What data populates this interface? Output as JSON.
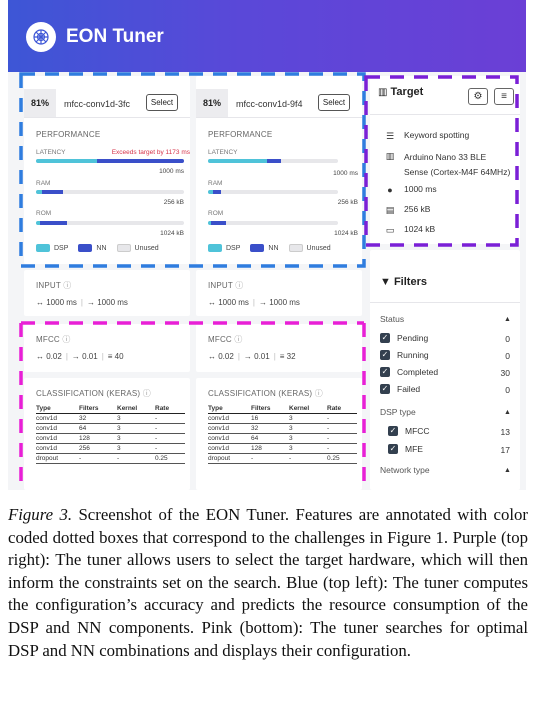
{
  "app": {
    "title": "EON Tuner"
  },
  "colors": {
    "dsp": "#4fc3d9",
    "nn": "#3a4fc9",
    "unused": "#e7e7ea",
    "purple_box": "#7a1fd6",
    "blue_box": "#2f7ddf",
    "pink_box": "#e81fd6"
  },
  "configs": [
    {
      "accuracy": "81%",
      "name": "mfcc-conv1d-3fc",
      "select_label": "Select",
      "performance_label": "PERFORMANCE",
      "latency_label": "LATENCY",
      "latency_note": "Exceeds target by 1173 ms",
      "latency_value": "1000 ms",
      "latency_dsp_pct": 41,
      "latency_nn_pct": 59,
      "ram_label": "RAM",
      "ram_value": "256 kB",
      "ram_dsp_pct": 4,
      "ram_nn_pct": 14,
      "rom_label": "ROM",
      "rom_value": "1024 kB",
      "rom_dsp_pct": 3,
      "rom_nn_pct": 18,
      "input_label": "INPUT",
      "input_window": "1000 ms",
      "input_stride": "1000 ms",
      "dsp_label": "MFCC",
      "dsp_frame": "0.02",
      "dsp_stride": "0.01",
      "dsp_coeffs": "40",
      "nn_label": "CLASSIFICATION (KERAS)",
      "table_head": [
        "Type",
        "Filters",
        "Kernel",
        "Rate"
      ],
      "rows": [
        [
          "conv1d",
          "32",
          "3",
          "-"
        ],
        [
          "conv1d",
          "64",
          "3",
          "-"
        ],
        [
          "conv1d",
          "128",
          "3",
          "-"
        ],
        [
          "conv1d",
          "256",
          "3",
          "-"
        ],
        [
          "dropout",
          "-",
          "-",
          "0.25"
        ]
      ]
    },
    {
      "accuracy": "81%",
      "name": "mfcc-conv1d-9f4",
      "select_label": "Select",
      "performance_label": "PERFORMANCE",
      "latency_label": "LATENCY",
      "latency_note": "",
      "latency_value": "1000 ms",
      "latency_dsp_pct": 45,
      "latency_nn_pct": 11,
      "ram_label": "RAM",
      "ram_value": "256 kB",
      "ram_dsp_pct": 4,
      "ram_nn_pct": 6,
      "rom_label": "ROM",
      "rom_value": "1024 kB",
      "rom_dsp_pct": 2,
      "rom_nn_pct": 12,
      "input_label": "INPUT",
      "input_window": "1000 ms",
      "input_stride": "1000 ms",
      "dsp_label": "MFCC",
      "dsp_frame": "0.02",
      "dsp_stride": "0.01",
      "dsp_coeffs": "32",
      "nn_label": "CLASSIFICATION (KERAS)",
      "table_head": [
        "Type",
        "Filters",
        "Kernel",
        "Rate"
      ],
      "rows": [
        [
          "conv1d",
          "16",
          "3",
          "-"
        ],
        [
          "conv1d",
          "32",
          "3",
          "-"
        ],
        [
          "conv1d",
          "64",
          "3",
          "-"
        ],
        [
          "conv1d",
          "128",
          "3",
          "-"
        ],
        [
          "dropout",
          "-",
          "-",
          "0.25"
        ]
      ]
    }
  ],
  "legend": {
    "dsp": "DSP",
    "nn": "NN",
    "unused": "Unused"
  },
  "target": {
    "title": "Target",
    "task": "Keyword spotting",
    "device_line1": "Arduino Nano 33 BLE",
    "device_line2": "Sense (Cortex-M4F 64MHz)",
    "latency": "1000 ms",
    "ram": "256 kB",
    "rom": "1024 kB"
  },
  "filters": {
    "title": "Filters",
    "status_label": "Status",
    "status_items": [
      {
        "label": "Pending",
        "count": "0"
      },
      {
        "label": "Running",
        "count": "0"
      },
      {
        "label": "Completed",
        "count": "30"
      },
      {
        "label": "Failed",
        "count": "0"
      }
    ],
    "dsp_label": "DSP type",
    "dsp_items": [
      {
        "label": "MFCC",
        "count": "13"
      },
      {
        "label": "MFE",
        "count": "17"
      }
    ],
    "network_label": "Network type"
  },
  "caption": {
    "label": "Figure 3.",
    "text": " Screenshot of the EON Tuner. Features are annotated with color coded dotted boxes that correspond to the challenges in Figure 1. Purple (top right): The tuner allows users to select the target hardware, which will then inform the constraints set on the search. Blue (top left): The tuner computes the configuration’s accuracy and predicts the resource consumption of the DSP and NN components. Pink (bottom): The tuner searches for optimal DSP and NN combinations and displays their configuration."
  }
}
